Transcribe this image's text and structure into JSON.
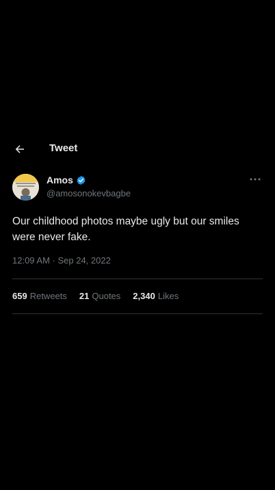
{
  "header": {
    "title": "Tweet",
    "back_icon": "arrow-left-icon"
  },
  "author": {
    "display_name": "Amos",
    "handle": "@amosonokevbagbe",
    "verified": true,
    "verified_color": "#1d9bf0"
  },
  "tweet": {
    "text": "Our childhood photos maybe ugly but our smiles were never fake.",
    "timestamp": "12:09 AM · Sep 24, 2022"
  },
  "stats": {
    "retweets_count": "659",
    "retweets_label": "Retweets",
    "quotes_count": "21",
    "quotes_label": "Quotes",
    "likes_count": "2,340",
    "likes_label": "Likes"
  },
  "colors": {
    "background": "#000000",
    "primary_text": "#e7e9ea",
    "secondary_text": "#71767b",
    "divider": "#2f3336"
  }
}
